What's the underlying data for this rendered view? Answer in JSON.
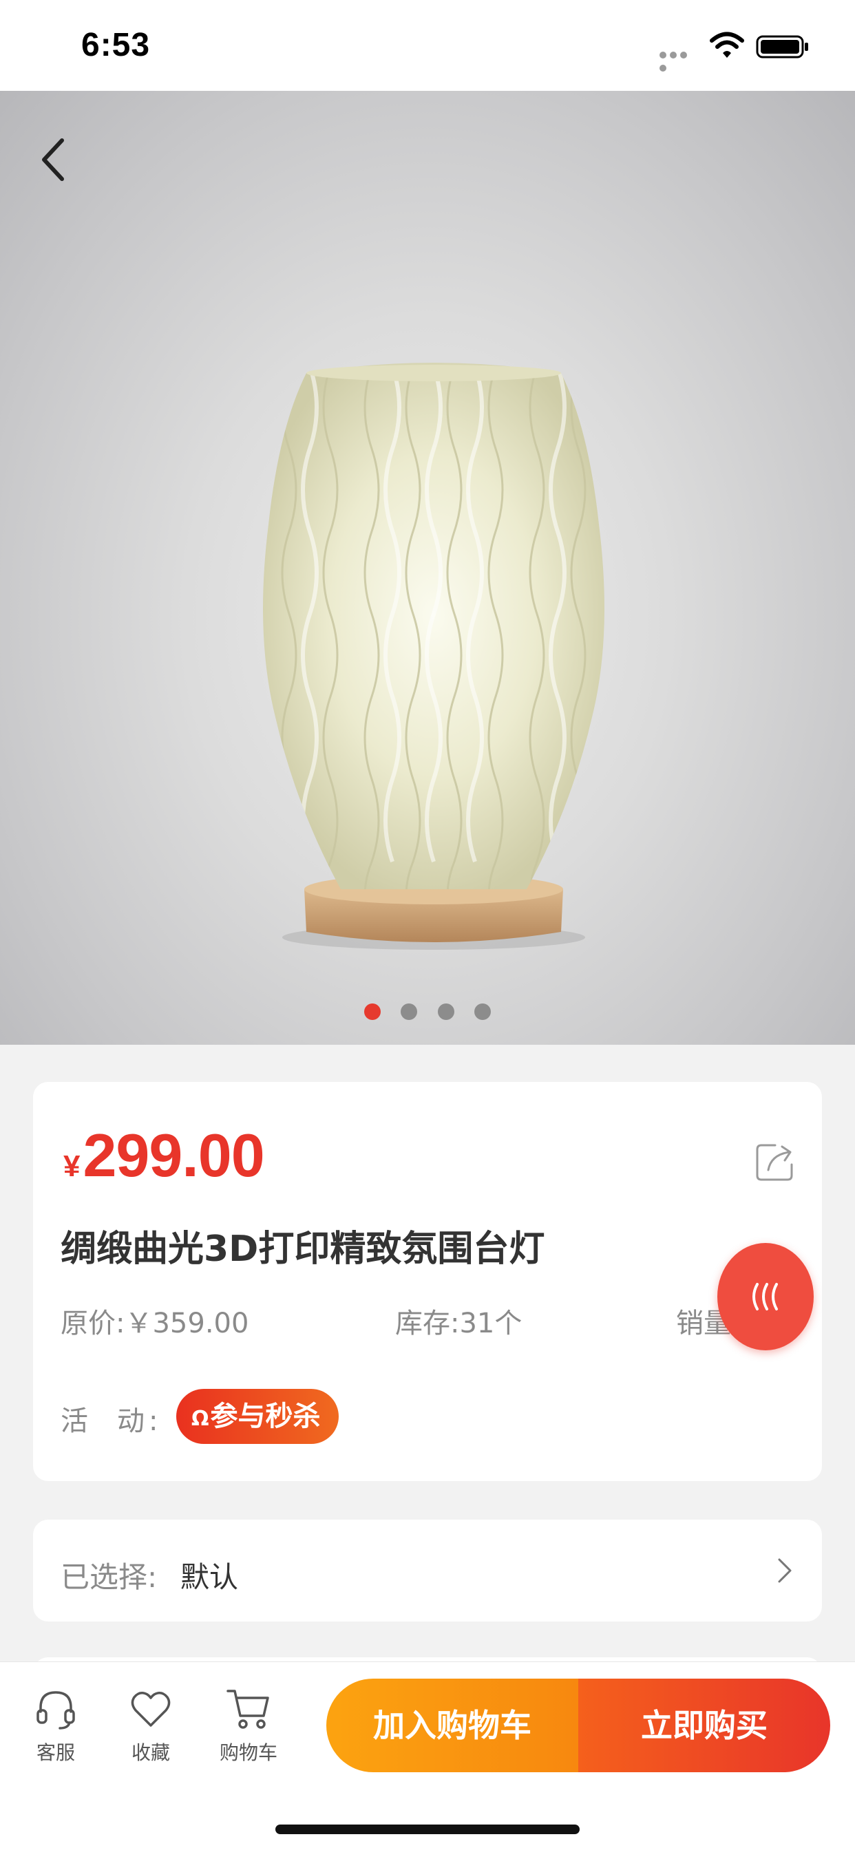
{
  "status_bar": {
    "time": "6:53"
  },
  "gallery": {
    "image_icon": "lamp-photo",
    "page_count": 4,
    "active_index": 0
  },
  "product": {
    "currency_symbol": "¥",
    "price": "299.00",
    "title": "绸缎曲光3D打印精致氛围台灯",
    "original_price": "原价:￥359.00",
    "stock": "库存:31个",
    "sales": "销量",
    "activity_label": "活",
    "activity_label_2": "动:",
    "seckill_badge_icon": "Ω",
    "seckill_badge_text": "参与秒杀"
  },
  "selection": {
    "label": "已选择:",
    "value": "默认"
  },
  "bottom_bar": {
    "service_label": "客服",
    "favorite_label": "收藏",
    "cart_label": "购物车",
    "add_to_cart": "加入购物车",
    "buy_now": "立即购买"
  },
  "colors": {
    "accent_red": "#e8352a",
    "accent_orange": "#fca310",
    "float_button": "#ef4d3f"
  }
}
